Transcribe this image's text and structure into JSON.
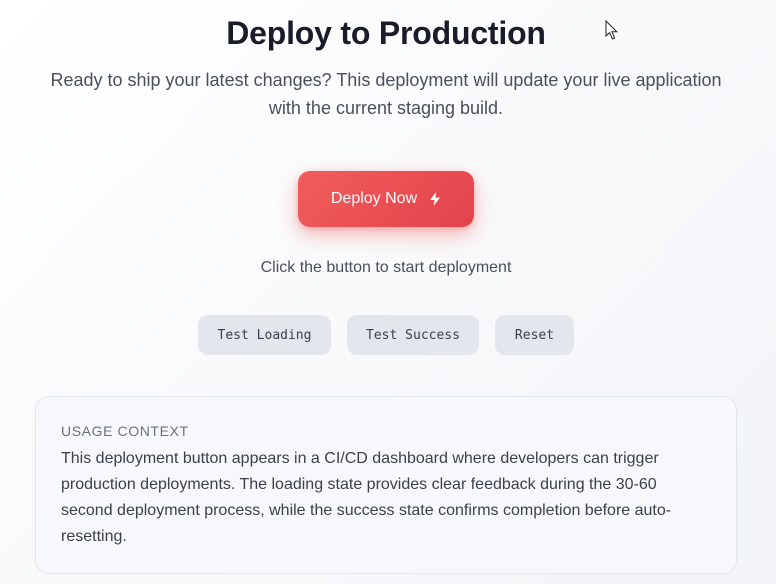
{
  "header": {
    "title": "Deploy to Production",
    "subtitle": "Ready to ship your latest changes? This deployment will update your live application with the current staging build."
  },
  "deploy_button": {
    "label": "Deploy Now",
    "icon": "lightning-bolt-icon",
    "gradient_start": "#f25c5c",
    "gradient_end": "#e2434b"
  },
  "status": {
    "text": "Click the button to start deployment"
  },
  "test_controls": {
    "test_loading_label": "Test Loading",
    "test_success_label": "Test Success",
    "reset_label": "Reset"
  },
  "usage_context": {
    "label": "USAGE CONTEXT",
    "text": "This deployment button appears in a CI/CD dashboard where developers can trigger production deployments. The loading state provides clear feedback during the 30-60 second deployment process, while the success state confirms completion before auto-resetting."
  },
  "colors": {
    "accent": "#ef4444",
    "text_primary": "#1a1d29",
    "text_secondary": "#4a4f5c",
    "control_bg": "#e3e6ec"
  }
}
